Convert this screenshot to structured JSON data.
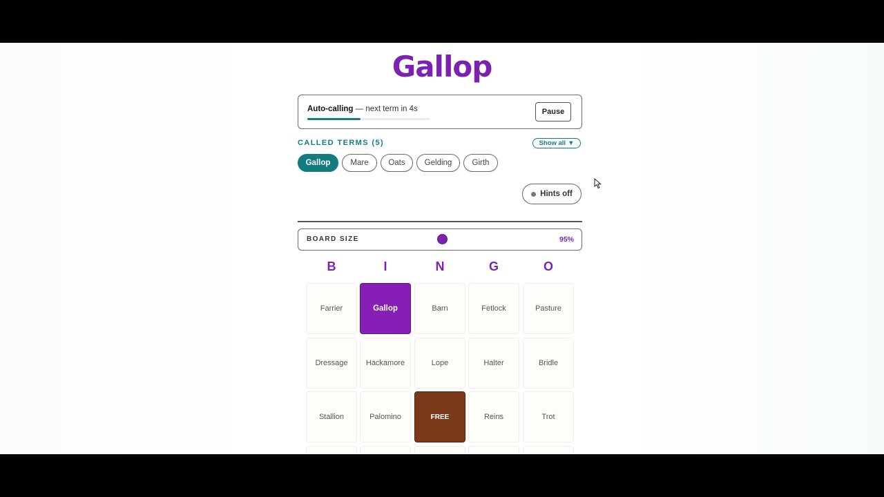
{
  "app": {
    "title": "Gallop",
    "accent": "#7b22b0",
    "teal": "#127c80"
  },
  "caller": {
    "status_bold": "Auto-calling",
    "status_rest": " — next term in 4s",
    "progress": 0.43,
    "pause_label": "Pause"
  },
  "called": {
    "heading": "CALLED TERMS (5)",
    "show_all_label": "Show all",
    "show_all_icon": "triangle-down-icon",
    "terms": [
      "Gallop",
      "Mare",
      "Oats",
      "Gelding",
      "Girth"
    ],
    "active_term": "Gallop"
  },
  "hints": {
    "label": "Hints off"
  },
  "board_size": {
    "label": "BOARD SIZE",
    "value_text": "95%",
    "value": 0.95
  },
  "board": {
    "letters": [
      "B",
      "I",
      "N",
      "G",
      "O"
    ],
    "rows": [
      [
        "Farrier",
        "Gallop",
        "Barn",
        "Fetlock",
        "Pasture"
      ],
      [
        "Dressage",
        "Hackamore",
        "Lope",
        "Halter",
        "Bridle"
      ],
      [
        "Stallion",
        "Palomino",
        "FREE",
        "Reins",
        "Trot"
      ],
      [
        "",
        "",
        "",
        "",
        ""
      ]
    ],
    "marked": [
      "Gallop"
    ],
    "free_label": "FREE",
    "marked_color": "#861fb5",
    "free_color": "#7a3a1a"
  }
}
